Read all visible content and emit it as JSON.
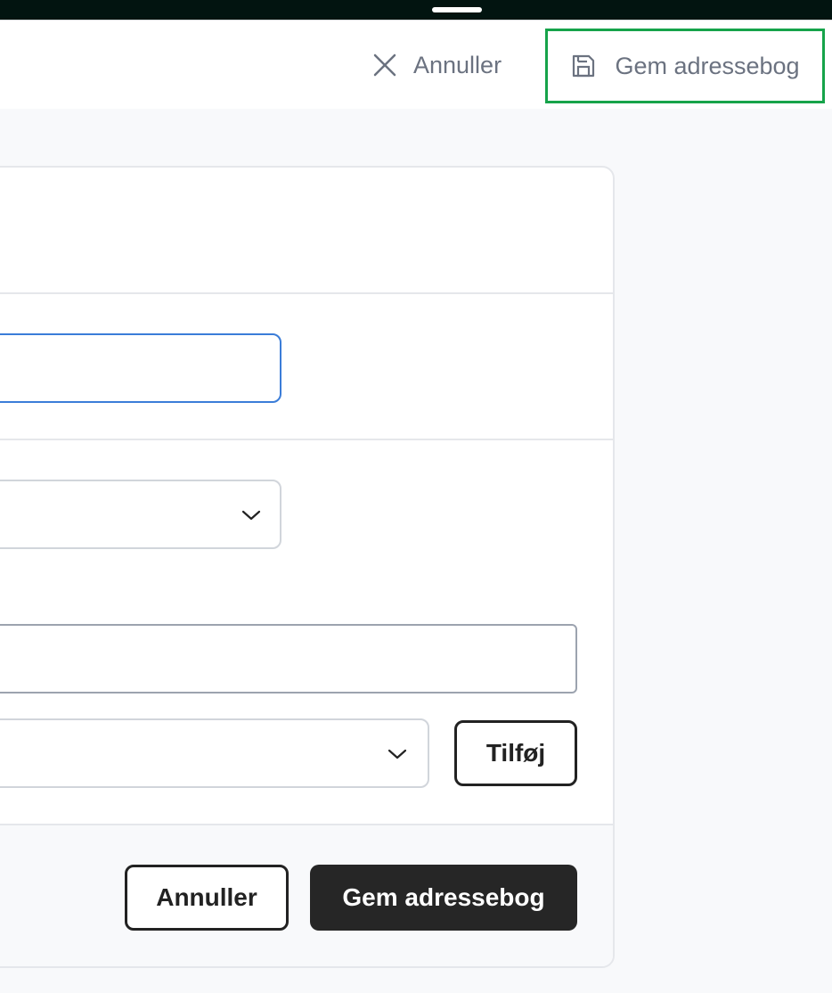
{
  "header": {
    "cancel_label": "Annuller",
    "save_label": "Gem adressebog",
    "highlight_color": "#16a34a"
  },
  "form": {
    "name_value": "",
    "type_select_value": "",
    "text_value": "",
    "add_select_value": "",
    "add_button_label": "Tilføj"
  },
  "footer": {
    "cancel_label": "Annuller",
    "save_label": "Gem adressebog"
  },
  "icons": {
    "close": "close-icon",
    "save": "floppy-disk-icon",
    "dropdown": "chevron-down-icon"
  }
}
